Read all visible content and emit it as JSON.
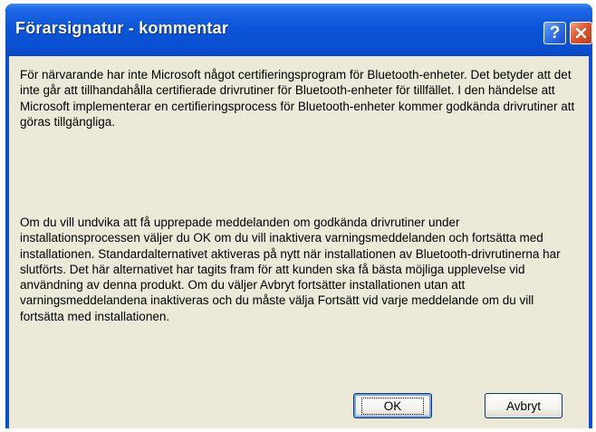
{
  "dialog": {
    "title": "Förarsignatur - kommentar",
    "icons": [
      "help-icon",
      "close-icon"
    ],
    "paragraphs": [
      "För närvarande har inte Microsoft något certifieringsprogram för Bluetooth-enheter. Det betyder att det inte går att tillhandahålla certifierade drivrutiner för Bluetooth-enheter för tillfället.  I den händelse att Microsoft implementerar en certifieringsprocess för Bluetooth-enheter kommer godkända drivrutiner att göras tillgängliga.",
      "Om du vill undvika att få upprepade meddelanden om godkända drivrutiner under installationsprocessen väljer du OK om du vill inaktivera varningsmeddelanden och fortsätta med installationen. Standardalternativet aktiveras på nytt när installationen av Bluetooth-drivrutinerna har slutförts. Det här alternativet har tagits fram för att kunden ska få bästa möjliga upplevelse vid användning av denna produkt. Om du väljer Avbryt fortsätter installationen utan att varningsmeddelandena inaktiveras och du måste välja Fortsätt vid varje meddelande om du vill fortsätta med installationen."
    ],
    "buttons": {
      "ok_label": "OK",
      "cancel_label": "Avbryt"
    }
  },
  "colors": {
    "titlebar": "#0a4fd8",
    "client_background": "#ece9d8",
    "close_button": "#e0582f",
    "help_button": "#2f6fe8"
  }
}
